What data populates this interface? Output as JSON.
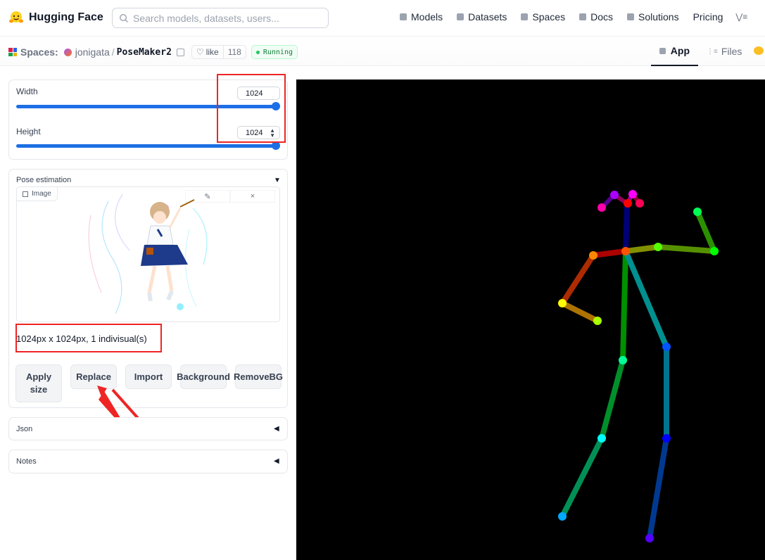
{
  "nav": {
    "brand": "Hugging Face",
    "search_placeholder": "Search models, datasets, users...",
    "links": [
      "Models",
      "Datasets",
      "Spaces",
      "Docs",
      "Solutions",
      "Pricing"
    ]
  },
  "header": {
    "spaces_label": "Spaces:",
    "owner": "jonigata",
    "separator": "/",
    "repo": "PoseMaker2",
    "like_label": "like",
    "like_count": "118",
    "status": "Running",
    "tabs": [
      "App",
      "Files"
    ]
  },
  "size_panel": {
    "width_label": "Width",
    "width_value": "1024",
    "width_slider_fraction": 1.0,
    "height_label": "Height",
    "height_value": "1024",
    "height_slider_fraction": 1.0
  },
  "pose_panel": {
    "title": "Pose estimation",
    "image_label": "Image",
    "edit_icon": "✎",
    "clear_icon": "×",
    "info": "1024px x 1024px, 1 indivisual(s)",
    "buttons": [
      "Apply size",
      "Replace",
      "Import",
      "Background",
      "RemoveBG"
    ]
  },
  "accordions": [
    "Json",
    "Notes"
  ],
  "colors": {
    "accent": "#1d6fe6",
    "annotation_red": "#ef2424",
    "status_green": "#15803d"
  }
}
